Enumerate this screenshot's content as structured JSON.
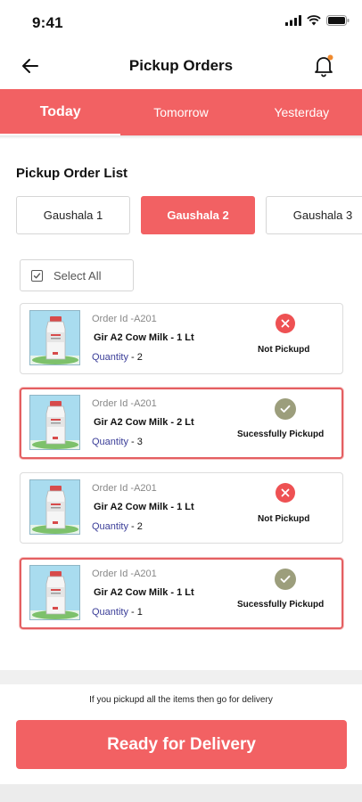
{
  "status_bar": {
    "time": "9:41"
  },
  "header": {
    "title": "Pickup Orders"
  },
  "tabs": [
    {
      "label": "Today",
      "active": true
    },
    {
      "label": "Tomorrow",
      "active": false
    },
    {
      "label": "Yesterday",
      "active": false
    }
  ],
  "section_title": "Pickup Order List",
  "gaushalas": [
    {
      "label": "Gaushala 1",
      "active": false
    },
    {
      "label": "Gaushala 2",
      "active": true
    },
    {
      "label": "Gaushala 3",
      "active": false
    }
  ],
  "select_all_label": "Select All",
  "orders": [
    {
      "order_id": "Order Id -A201",
      "product": "Gir A2 Cow Milk  - 1 Lt",
      "quantity_label": "Quantity",
      "quantity": "2",
      "status": "Not Pickupd",
      "status_icon": "cross-icon"
    },
    {
      "order_id": "Order Id -A201",
      "product": "Gir A2 Cow Milk  - 2 Lt",
      "quantity_label": "Quantity",
      "quantity": "3",
      "status": "Sucessfully Pickupd",
      "status_icon": "check-icon"
    },
    {
      "order_id": "Order Id -A201",
      "product": "Gir A2 Cow Milk  - 1 Lt",
      "quantity_label": "Quantity",
      "quantity": "2",
      "status": "Not Pickupd",
      "status_icon": "cross-icon"
    },
    {
      "order_id": "Order Id -A201",
      "product": "Gir A2 Cow Milk  - 1 Lt",
      "quantity_label": "Quantity",
      "quantity": "1",
      "status": "Sucessfully Pickupd",
      "status_icon": "check-icon"
    }
  ],
  "footer": {
    "hint": "If you pickupd all the items then go for delivery",
    "cta_label": "Ready for Delivery"
  },
  "colors": {
    "accent": "#f26163",
    "error": "#ee5153",
    "success": "#9c9e7c",
    "quantity_label": "#3a3d98"
  }
}
